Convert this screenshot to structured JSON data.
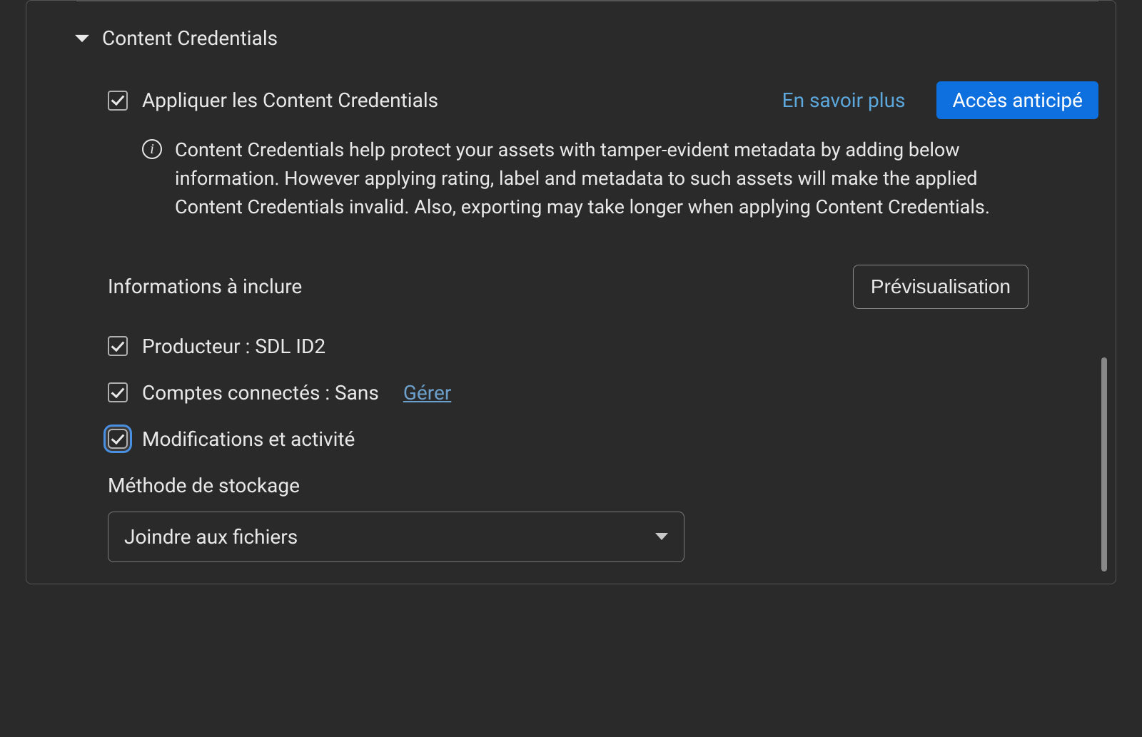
{
  "section": {
    "title": "Content Credentials",
    "apply_label": "Appliquer les Content Credentials",
    "learn_more": "En savoir plus",
    "badge": "Accès anticipé",
    "info_icon": "i",
    "info_text": "Content Credentials help protect your assets with tamper-evident metadata by adding below information. However applying rating, label and metadata to such assets will make the applied Content Credentials invalid. Also, exporting may take longer when applying Content Credentials.",
    "includes_label": "Informations à inclure",
    "preview_button": "Prévisualisation",
    "options": {
      "producer": "Producteur : SDL ID2",
      "accounts": "Comptes connectés : Sans",
      "manage": "Gérer",
      "modifications": "Modifications et activité"
    },
    "storage_label": "Méthode de stockage",
    "storage_value": "Joindre aux fichiers"
  }
}
